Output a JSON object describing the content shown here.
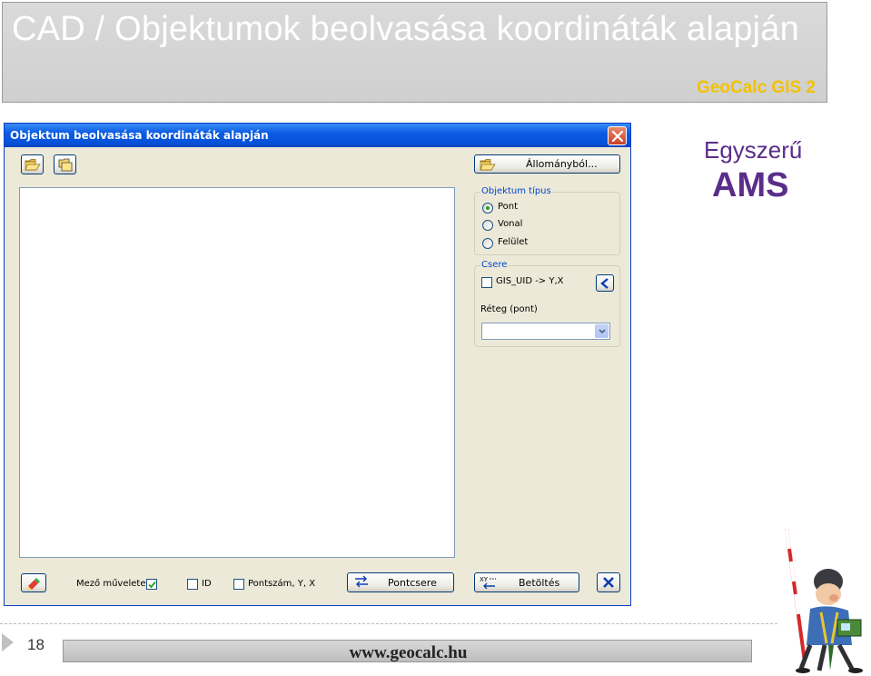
{
  "slide": {
    "title": "CAD / Objektumok beolvasása koordináták alapján",
    "brand": "GeoCalc GIS 2",
    "side_text_1": "Egyszerű",
    "side_text_2": "AMS",
    "page_number": "18",
    "footer_url": "www.geocalc.hu"
  },
  "window": {
    "title": "Objektum beolvasása koordináták alapján",
    "buttons": {
      "from_file": "Állományból...",
      "point_swap": "Pontcsere",
      "load": "Betöltés"
    },
    "object_type": {
      "title": "Objektum típus",
      "options": [
        "Pont",
        "Vonal",
        "Felület"
      ],
      "selected": "Pont"
    },
    "swap": {
      "title": "Csere",
      "checkbox_label": "GIS_UID -> Y,X",
      "checked": false,
      "layer_label": "Réteg (pont)",
      "layer_value": ""
    },
    "bottom": {
      "field_ops_label": "Mező műveletek",
      "field_ops_checked": true,
      "id_label": "ID",
      "id_checked": false,
      "pointnum_label": "Pontszám, Y, X",
      "pointnum_checked": false
    }
  },
  "colors": {
    "titlebar": "#0550d8",
    "brand": "#f2c200",
    "ams": "#5a2d8a",
    "window_bg": "#ece9d8",
    "group_title": "#0046d5"
  }
}
